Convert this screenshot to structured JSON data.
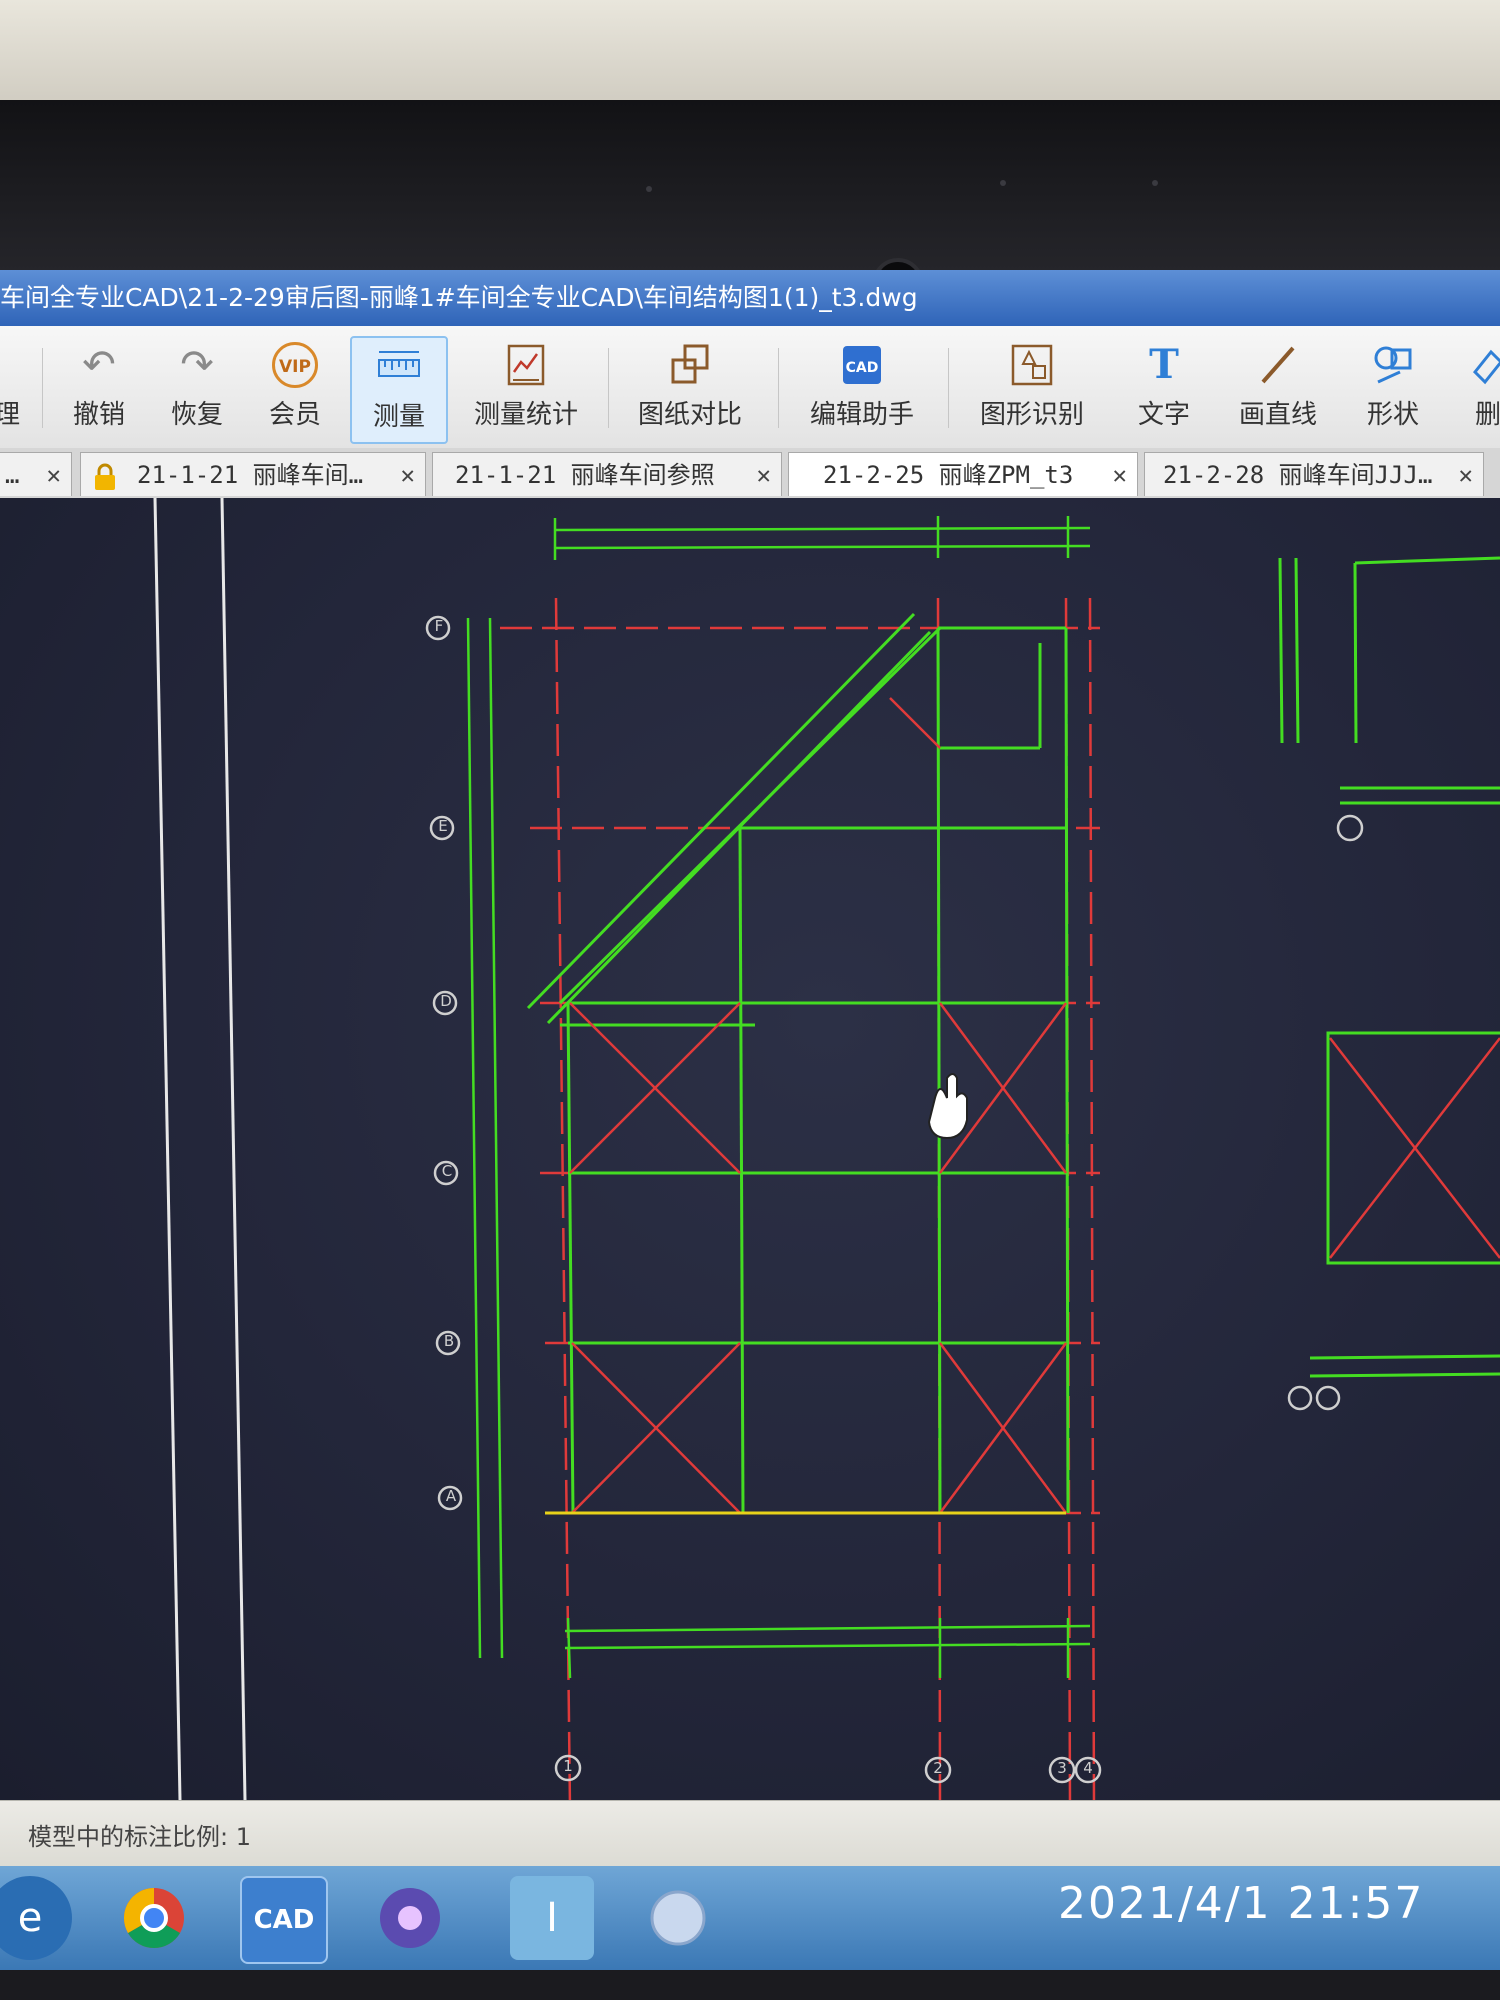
{
  "window": {
    "title": "车间全专业CAD\\21-2-29审后图-丽峰1#车间全专业CAD\\车间结构图1(1)_t3.dwg"
  },
  "toolbar": {
    "items": [
      {
        "label": "理",
        "icon": "partial-icon"
      },
      {
        "label": "撤销",
        "icon": "undo-icon"
      },
      {
        "label": "恢复",
        "icon": "redo-icon"
      },
      {
        "label": "会员",
        "icon": "vip-icon"
      },
      {
        "label": "测量",
        "icon": "measure-ruler-icon"
      },
      {
        "label": "测量统计",
        "icon": "measure-stats-icon"
      },
      {
        "label": "图纸对比",
        "icon": "compare-icon"
      },
      {
        "label": "编辑助手",
        "icon": "edit-assistant-icon"
      },
      {
        "label": "图形识别",
        "icon": "shape-recognize-icon"
      },
      {
        "label": "文字",
        "icon": "text-icon"
      },
      {
        "label": "画直线",
        "icon": "line-icon"
      },
      {
        "label": "形状",
        "icon": "shape-icon"
      },
      {
        "label": "删",
        "icon": "eraser-icon"
      }
    ],
    "vip_badge": "VIP"
  },
  "tabs": [
    {
      "label": "…",
      "close": "✕"
    },
    {
      "label": "21-1-21 丽峰车间…",
      "close": "✕"
    },
    {
      "label": "21-1-21 丽峰车间参照",
      "close": "✕"
    },
    {
      "label": "21-2-25 丽峰ZPM_t3",
      "close": "✕"
    },
    {
      "label": "21-2-28 丽峰车间JJJ…",
      "close": "✕"
    }
  ],
  "drawing": {
    "grid_rows": [
      "F",
      "E",
      "D",
      "C",
      "B",
      "A"
    ],
    "grid_cols": [
      "1",
      "2",
      "3",
      "4"
    ],
    "colors": {
      "grid": "#e03a3a",
      "member": "#44dd22",
      "bubble": "#cfcfcf",
      "accent": "#e8d21a"
    }
  },
  "status": {
    "text": "模型中的标注比例: 1"
  },
  "taskbar": {
    "icons": [
      "ie-icon",
      "chrome-icon",
      "cad-icon",
      "app-icon",
      "input-icon",
      "game-icon"
    ],
    "cad_label": "CAD",
    "clock": "2021/4/1  21:57"
  }
}
